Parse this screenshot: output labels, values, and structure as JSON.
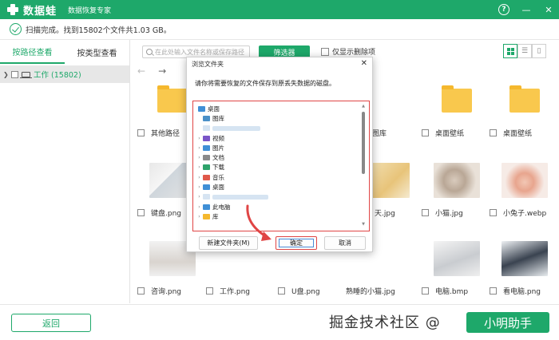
{
  "app": {
    "name": "数据蛙",
    "subtitle": "数据恢复专家",
    "help_glyph": "?",
    "minimize_glyph": "—",
    "close_glyph": "✕"
  },
  "status": {
    "text": "扫描完成。找到15802个文件共1.03 GB。"
  },
  "left_tabs": [
    {
      "label": "按路径查看",
      "active": true
    },
    {
      "label": "按类型查看",
      "active": false
    }
  ],
  "tree": {
    "item_label": "工作 (15802)"
  },
  "toolbar": {
    "search_placeholder": "在此处输入文件名称或保存路径",
    "filter_label": "筛选器",
    "only_deleted_label": "仅显示删除项"
  },
  "tiles": {
    "row1": [
      "其他路径",
      "",
      "",
      "",
      "帮图库",
      "桌面壁纸",
      "桌面壁纸"
    ],
    "row2": [
      "键盘.png",
      "",
      "",
      "",
      "天.jpg",
      "小猫.jpg",
      "小兔子.webp"
    ],
    "row3": [
      "咨询.png",
      "工作.png",
      "U盘.png",
      "熟睡的小猫.jpg",
      "电脑.bmp",
      "看电脑.png"
    ]
  },
  "dialog": {
    "title": "浏览文件夹",
    "message": "请你将需要恢复的文件保存到原丢失数据的磁盘。",
    "folders": [
      {
        "label": "桌面",
        "indent": 0,
        "caret": "",
        "color": "#3f8fd6"
      },
      {
        "label": "图库",
        "indent": 1,
        "caret": "",
        "color": "#4a90c8"
      },
      {
        "label": "",
        "indent": 1,
        "caret": "",
        "color": "#d6e4f2",
        "blurred": true
      },
      {
        "label": "视频",
        "indent": 1,
        "caret": "›",
        "color": "#7a55c8"
      },
      {
        "label": "图片",
        "indent": 1,
        "caret": "›",
        "color": "#3f8fd6"
      },
      {
        "label": "文档",
        "indent": 1,
        "caret": "›",
        "color": "#8a8a8a"
      },
      {
        "label": "下载",
        "indent": 1,
        "caret": "›",
        "color": "#2ea36b"
      },
      {
        "label": "音乐",
        "indent": 1,
        "caret": "›",
        "color": "#e0584a"
      },
      {
        "label": "桌面",
        "indent": 1,
        "caret": "›",
        "color": "#3f8fd6"
      },
      {
        "label": "",
        "indent": 1,
        "caret": "›",
        "color": "#d6e4f2",
        "blurred": true
      },
      {
        "label": "此电脑",
        "indent": 1,
        "caret": "›",
        "color": "#3f8fd6"
      },
      {
        "label": "库",
        "indent": 1,
        "caret": "›",
        "color": "#f5b82e"
      }
    ],
    "new_folder_label": "新建文件夹(M)",
    "ok_label": "确定",
    "cancel_label": "取消"
  },
  "bottom": {
    "back_label": "返回",
    "watermark": "掘金技术社区 @",
    "right_button_label": "小明助手"
  },
  "colors": {
    "brand": "#1ea86a",
    "highlight": "#e04545"
  }
}
